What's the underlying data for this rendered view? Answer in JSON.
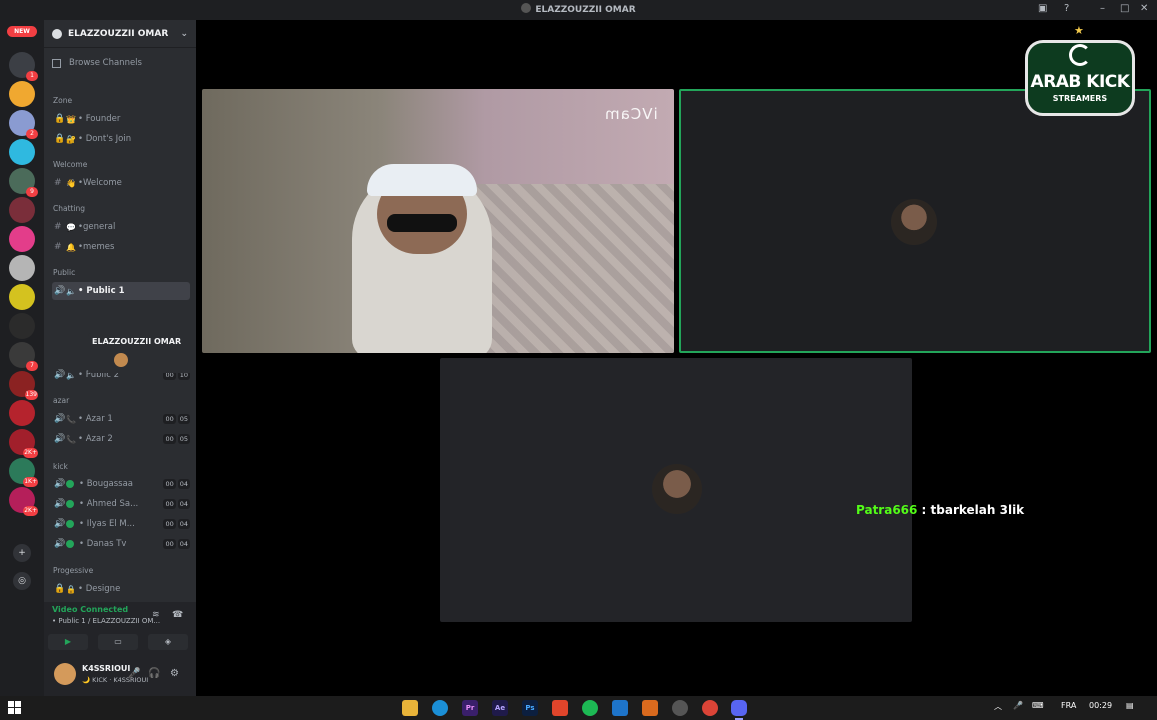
{
  "window": {
    "title": "ELAZZOUZZII OMAR"
  },
  "servers": {
    "new_label": "NEW",
    "items": [
      {
        "color": "#3c3f45",
        "badge": "1"
      },
      {
        "color": "#f0a830",
        "badge": ""
      },
      {
        "color": "#8a9bd1",
        "badge": "2"
      },
      {
        "color": "#2fb9e0",
        "badge": ""
      },
      {
        "color": "#4b6b5a",
        "badge": "9"
      },
      {
        "color": "#7a2e3a",
        "badge": ""
      },
      {
        "color": "#e33d8a",
        "badge": ""
      },
      {
        "color": "#b5b5b5",
        "badge": ""
      },
      {
        "color": "#d4c21f",
        "badge": ""
      },
      {
        "color": "#2b2b2b",
        "badge": ""
      },
      {
        "color": "#3a3a3a",
        "badge": "7"
      },
      {
        "color": "#8b2222",
        "badge": "139"
      },
      {
        "color": "#b5232d",
        "badge": ""
      },
      {
        "color": "#a11f2b",
        "badge": "2K+"
      },
      {
        "color": "#2c7a5a",
        "badge": "1K+"
      },
      {
        "color": "#b51f5a",
        "badge": "2K+"
      }
    ]
  },
  "guild": {
    "name": "ELAZZOUZZII OMAR",
    "browse": "Browse Channels",
    "categories": [
      {
        "name": "Zone",
        "channels": [
          {
            "emoji": "👑",
            "name": "• Founder"
          },
          {
            "emoji": "🔐",
            "name": "• Dont's Join"
          }
        ]
      },
      {
        "name": "Welcome",
        "channels": [
          {
            "emoji": "👋",
            "name": "•Welcome"
          }
        ]
      },
      {
        "name": "Chatting",
        "channels": [
          {
            "emoji": "💬",
            "name": "•general"
          },
          {
            "emoji": "🔔",
            "name": "•memes"
          }
        ]
      },
      {
        "name": "Public",
        "channels": [
          {
            "emoji": "🔈",
            "name": "• Public 1"
          },
          {
            "emoji": "🔈",
            "name": "• Public 2",
            "c1": "00",
            "c2": "10"
          }
        ]
      },
      {
        "name": "azar",
        "channels": [
          {
            "emoji": "📞",
            "name": "• Azar 1",
            "c1": "00",
            "c2": "05"
          },
          {
            "emoji": "📞",
            "name": "• Azar 2",
            "c1": "00",
            "c2": "05"
          }
        ]
      },
      {
        "name": "kick",
        "channels": [
          {
            "name": "• Bougassaa",
            "c1": "00",
            "c2": "04"
          },
          {
            "name": "• Ahmed Sa...",
            "c1": "00",
            "c2": "04"
          },
          {
            "name": "• Ilyas El M...",
            "c1": "00",
            "c2": "04"
          },
          {
            "name": "• Danas Tv",
            "c1": "00",
            "c2": "04"
          }
        ]
      },
      {
        "name": "Progessive",
        "channels": [
          {
            "emoji": "🔒",
            "name": "• Designe"
          }
        ]
      }
    ],
    "voice_user": "ELAZZOUZZII OMAR"
  },
  "voice": {
    "status": "Video Connected",
    "channel": "• Public 1 / ELAZZOUZZII OM..."
  },
  "user": {
    "name": "K4SSRIOUI",
    "status": "🌙 KICK · K4SSRIOUI"
  },
  "stage": {
    "cam_watermark": "iVCam",
    "chat_user": "Patra666",
    "chat_message": " : tbarkelah 3lik"
  },
  "logo": {
    "line1": "ARAB KICK",
    "line2": "STREAMERS"
  },
  "taskbar": {
    "language": "FRA",
    "time": "00:29"
  },
  "colors": {
    "accent_green": "#23a55a",
    "chat_user_green": "#53fc18"
  }
}
